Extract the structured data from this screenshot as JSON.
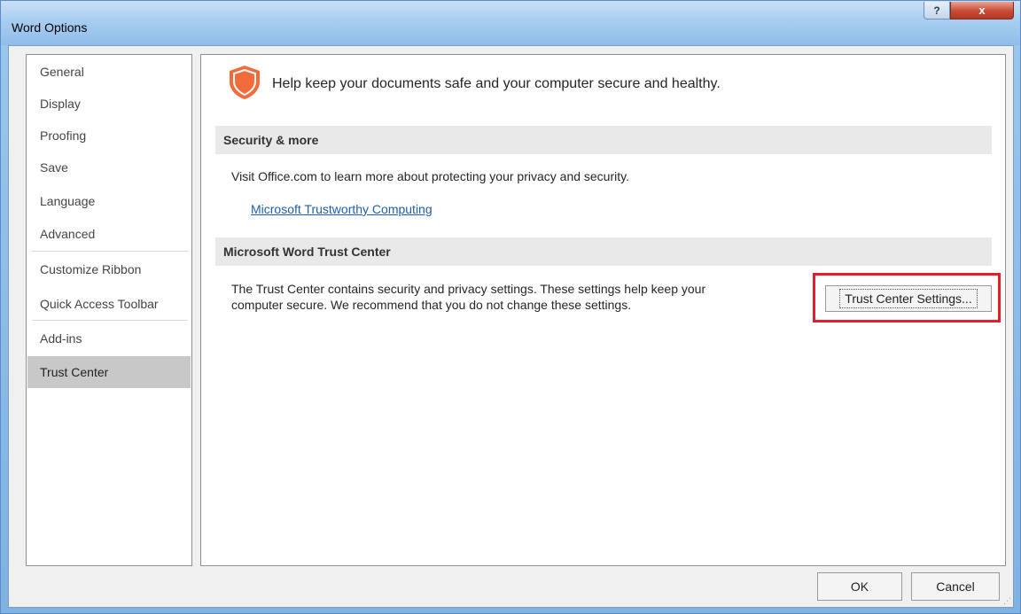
{
  "window": {
    "title": "Word Options",
    "help_label": "?",
    "close_label": "x"
  },
  "sidebar": {
    "items": [
      {
        "label": "General"
      },
      {
        "label": "Display"
      },
      {
        "label": "Proofing"
      },
      {
        "label": "Save"
      },
      {
        "label": "Language"
      },
      {
        "label": "Advanced"
      },
      {
        "label": "Customize Ribbon"
      },
      {
        "label": "Quick Access Toolbar"
      },
      {
        "label": "Add-ins"
      },
      {
        "label": "Trust Center"
      }
    ],
    "selected": "Trust Center"
  },
  "content": {
    "headline": "Help keep your documents safe and your computer secure and healthy.",
    "section_security": {
      "title": "Security & more",
      "text": "Visit Office.com to learn more about protecting your privacy and security.",
      "link": "Microsoft Trustworthy Computing"
    },
    "section_trust": {
      "title": "Microsoft Word Trust Center",
      "text_line1": "The Trust Center contains security and privacy settings. These settings help keep your",
      "text_line2": "computer secure. We recommend that you do not change these settings.",
      "button_label": "Trust Center Settings..."
    }
  },
  "footer": {
    "ok_label": "OK",
    "cancel_label": "Cancel"
  },
  "colors": {
    "shield": "#f26b3a",
    "highlight": "#e0202a",
    "link": "#1f5ea8",
    "selected_nav": "#c8c8c8"
  }
}
